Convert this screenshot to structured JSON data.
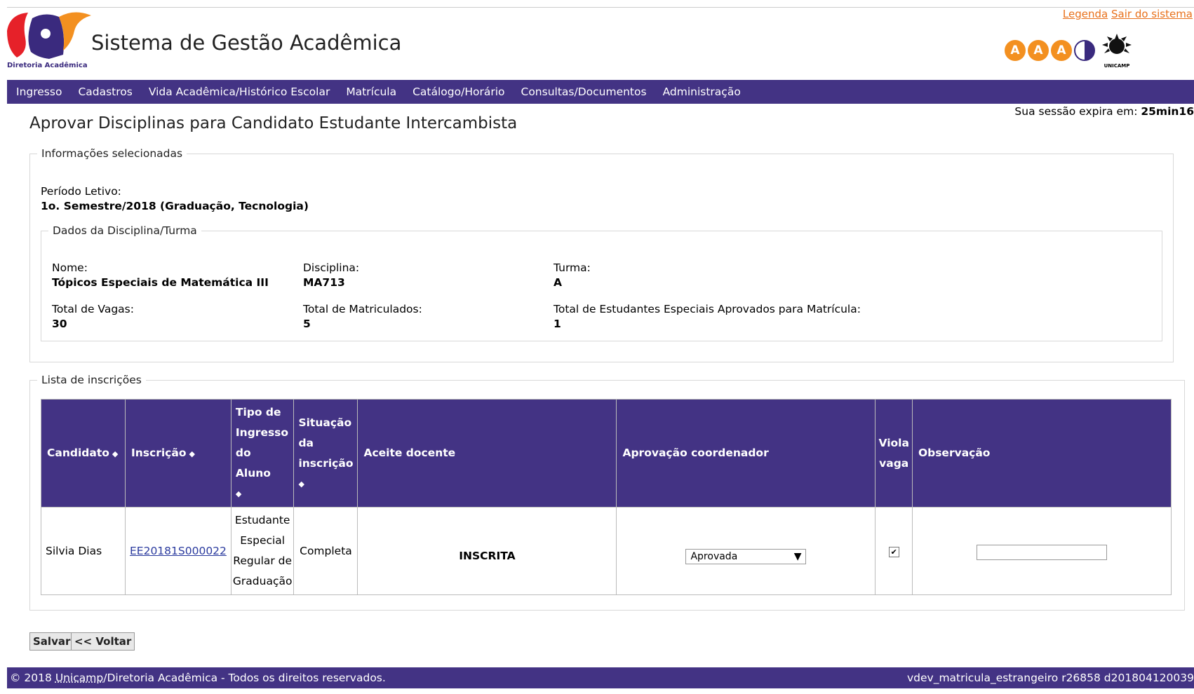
{
  "header": {
    "links": [
      "Legenda",
      "Sair do sistema"
    ],
    "logo_caption": "Diretoria Acadêmica",
    "app_title": "Sistema de Gestão Acadêmica",
    "accessibility_badges": [
      "A",
      "A",
      "A"
    ],
    "unicamp_caption": "UNICAMP"
  },
  "nav": [
    "Ingresso",
    "Cadastros",
    "Vida Acadêmica/Histórico Escolar",
    "Matrícula",
    "Catálogo/Horário",
    "Consultas/Documentos",
    "Administração"
  ],
  "session": {
    "label": "Sua sessão expira em:",
    "time": "25min16"
  },
  "page_title": "Aprovar Disciplinas para Candidato Estudante Intercambista",
  "info": {
    "legend": "Informações selecionadas",
    "periodo_label": "Período Letivo:",
    "periodo_value": "1o. Semestre/2018 (Graduação, Tecnologia)",
    "dados": {
      "legend": "Dados da Disciplina/Turma",
      "nome_label": "Nome:",
      "nome_value": "Tópicos Especiais de Matemática III",
      "disciplina_label": "Disciplina:",
      "disciplina_value": "MA713",
      "turma_label": "Turma:",
      "turma_value": "A",
      "vagas_label": "Total de Vagas:",
      "vagas_value": "30",
      "matriculados_label": "Total de Matriculados:",
      "matriculados_value": "5",
      "especiais_label": "Total de Estudantes Especiais Aprovados para Matrícula:",
      "especiais_value": "1"
    }
  },
  "lista": {
    "legend": "Lista de inscrições",
    "headers": {
      "candidato": "Candidato",
      "inscricao": "Inscrição",
      "tipo_l1": "Tipo de",
      "tipo_l2": "Ingresso",
      "tipo_l3": "do Aluno",
      "situacao_l1": "Situação",
      "situacao_l2": "da",
      "situacao_l3": "inscrição",
      "aceite": "Aceite docente",
      "aprovacao": "Aprovação coordenador",
      "viola_l1": "Viola",
      "viola_l2": "vaga",
      "observacao": "Observação"
    },
    "row": {
      "candidato": "Silvia Dias",
      "inscricao": "EE20181S000022",
      "tipo_l1": "Estudante",
      "tipo_l2": "Especial",
      "tipo_l3": "Regular de",
      "tipo_l4": "Graduação",
      "situacao": "Completa",
      "aceite": "INSCRITA",
      "aprovacao": "Aprovada",
      "viola_checked": true,
      "observacao": ""
    }
  },
  "buttons": {
    "salvar": "Salvar",
    "voltar": "<< Voltar"
  },
  "footer": {
    "copyright_prefix": "© 2018 ",
    "unicamp": "Unicamp",
    "copyright_suffix": "/Diretoria Acadêmica - Todos os direitos reservados.",
    "version": "vdev_matricula_estrangeiro r26858 d201804120039"
  },
  "colors": {
    "nav_bg": "#433384",
    "link_orange": "#e8701a",
    "badge_orange": "#f39020"
  }
}
